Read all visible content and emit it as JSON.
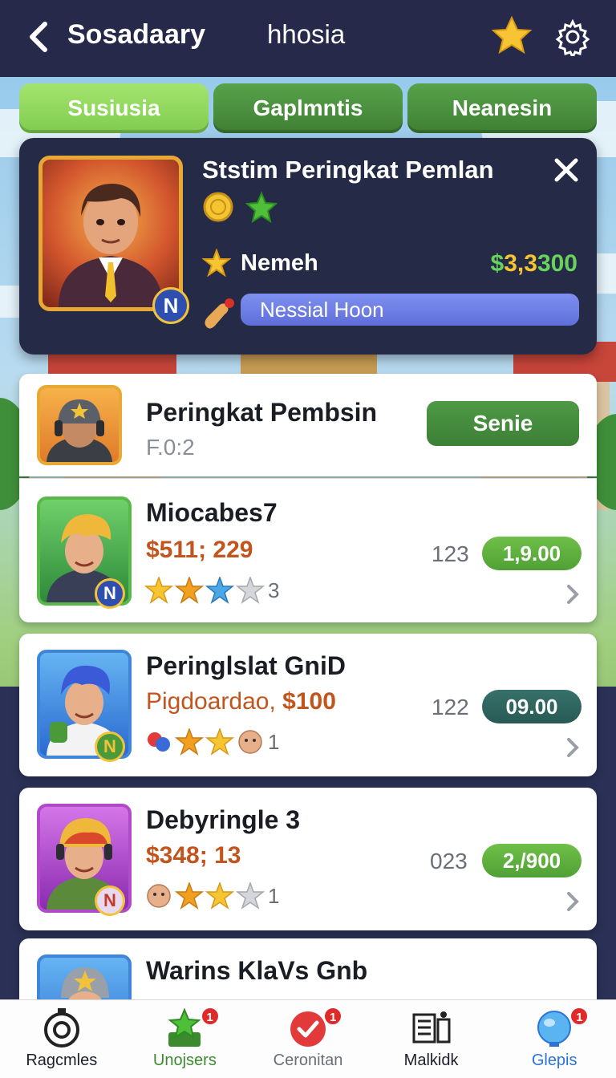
{
  "header": {
    "app_title": "Sosadaary",
    "center_title": "hhosia",
    "back_icon": "chevron-left-icon",
    "star_icon": "star-icon",
    "gear_icon": "gear-icon"
  },
  "tabs": [
    {
      "label": "Susiusia",
      "active": true
    },
    {
      "label": "Gaplmntis",
      "active": false
    },
    {
      "label": "Neanesin",
      "active": false
    }
  ],
  "profile": {
    "title": "Ststim Peringkat Pemlan",
    "badge_letter": "N",
    "rank_name": "Nemeh",
    "balance_prefix": "$",
    "balance_mid": "3,3",
    "balance_suffix": "300",
    "status_label": "Nessial Hoon"
  },
  "list": {
    "header_item": {
      "title": "Peringkat Pembsin",
      "subtitle": "F.0:2",
      "button_label": "Senie"
    },
    "items": [
      {
        "title": "Miocabes7",
        "price_amount": "$511; 229",
        "rank": "123",
        "pill_label": "1,9.00",
        "pill_style": "green",
        "star_count": "3",
        "badge": "N"
      },
      {
        "title": "Peringlslat GniD",
        "price_label": "Pigdoardao,",
        "price_amount": "$100",
        "rank": "122",
        "pill_label": "09.00",
        "pill_style": "teal",
        "star_count": "1",
        "badge": "N"
      },
      {
        "title": "Debyringle 3",
        "price_amount": "$348; 13",
        "rank": "023",
        "pill_label": "2,/900",
        "pill_style": "green",
        "star_count": "1",
        "badge": "N"
      },
      {
        "title": "Warins KlaVs Gnb"
      }
    ]
  },
  "bottom_nav": [
    {
      "label": "Ragcmles",
      "icon": "target-icon",
      "badge": ""
    },
    {
      "label": "Unojsers",
      "icon": "star-trophy-icon",
      "badge": "1"
    },
    {
      "label": "Ceronitan",
      "icon": "check-circle-icon",
      "badge": "1"
    },
    {
      "label": "Malkidk",
      "icon": "list-chart-icon",
      "badge": ""
    },
    {
      "label": "Glepis",
      "icon": "globe-icon",
      "badge": "1"
    }
  ],
  "colors": {
    "header_bg": "#26294a",
    "tab_active": "#a4e46e",
    "tab_inactive": "#58a24a",
    "panel_bg": "#252a46",
    "status_bar": "#6f7fe6",
    "price": "#c2541d",
    "pill_green": "#5fb03e",
    "pill_teal": "#2f6560",
    "nav_active_green": "#3c8a2e",
    "nav_active_blue": "#2c73d8"
  }
}
